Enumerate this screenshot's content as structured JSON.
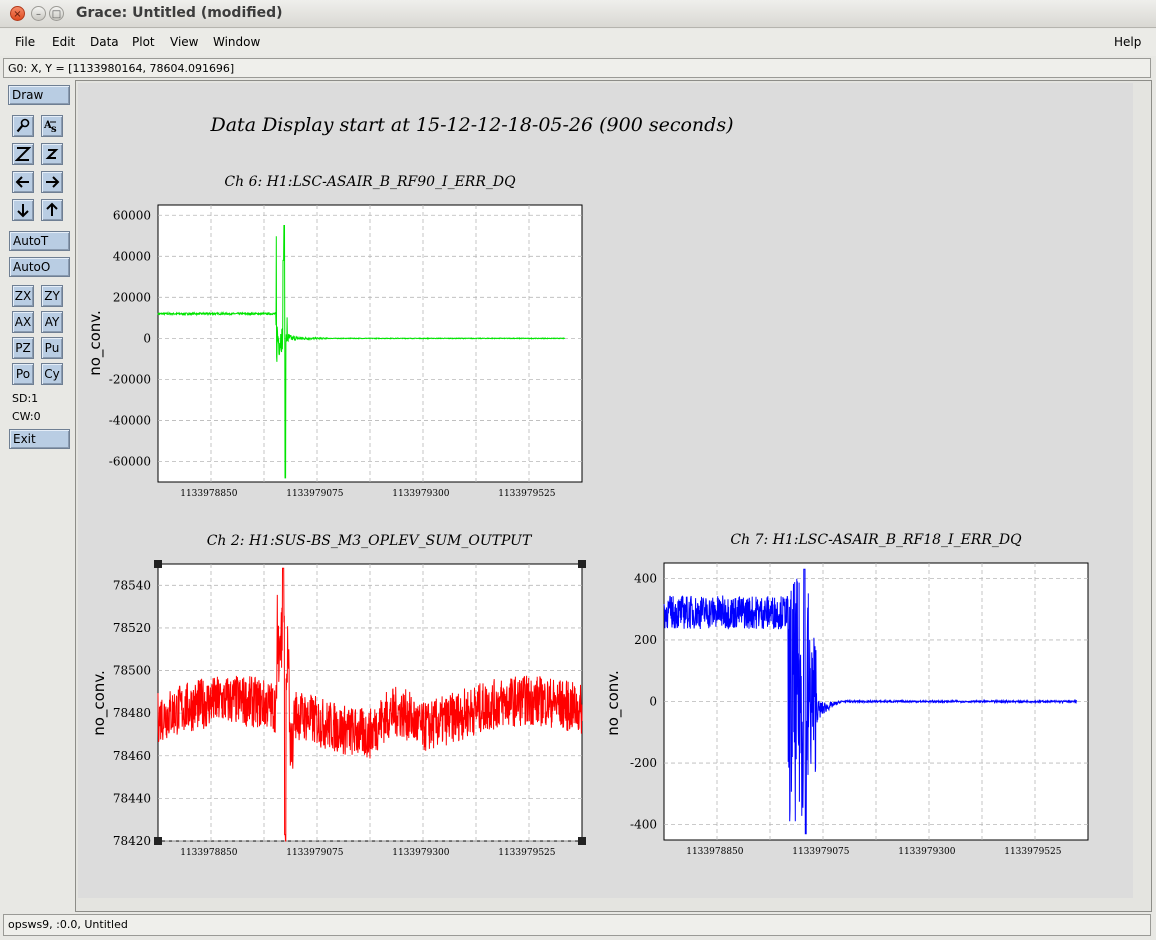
{
  "window": {
    "title": "Grace: Untitled (modified)"
  },
  "menu": {
    "items": [
      "File",
      "Edit",
      "Data",
      "Plot",
      "View",
      "Window"
    ],
    "help": "Help"
  },
  "locator": "G0: X, Y = [1133980164, 78604.091696]",
  "toolbar": {
    "draw": "Draw",
    "autot": "AutoT",
    "autoo": "AutoO",
    "zx": "ZX",
    "zy": "ZY",
    "ax": "AX",
    "ay": "AY",
    "pz": "PZ",
    "pu": "Pu",
    "po": "Po",
    "cy": "Cy",
    "sd": "SD:1",
    "cw": "CW:0",
    "exit": "Exit",
    "icons": [
      "zoom-magnifier-icon",
      "text-autoscale-icon",
      "zoom-z-large-icon",
      "zoom-z-small-icon",
      "scroll-left-icon",
      "scroll-right-icon",
      "scroll-down-icon",
      "scroll-up-icon"
    ]
  },
  "status": "opsws9, :0.0, Untitled",
  "colors": {
    "ch6": "#00e400",
    "ch2": "#ff0000",
    "ch7": "#0000ff"
  },
  "chart_data": {
    "title": "Data Display start at 15-12-12-18-05-26 (900 seconds)",
    "plots": [
      {
        "name": "Ch 6: H1:LSC-ASAIR_B_RF90_I_ERR_DQ",
        "type": "line",
        "ylabel": "no_conv.",
        "ylim": [
          -70000,
          65000
        ],
        "yticks": [
          60000,
          40000,
          20000,
          0,
          -20000,
          -40000,
          -60000
        ],
        "xticks": [
          "1133978850",
          "1133979075",
          "1133979300",
          "1133979525"
        ],
        "description": "flat ~12000 until ~1133978900, burst between ~1133979000 and ~1133979120 (spike to ~55000 and ~-68000), then ~0"
      },
      {
        "name": "Ch 2: H1:SUS-BS_M3_OPLEV_SUM_OUTPUT",
        "type": "line",
        "ylabel": "no_conv.",
        "ylim": [
          78420,
          78550
        ],
        "yticks": [
          78540,
          78520,
          78500,
          78480,
          78460,
          78440,
          78420
        ],
        "xticks": [
          "1133978850",
          "1133979075",
          "1133979300",
          "1133979525"
        ],
        "description": "noisy around 78470-78495, spike to ~78548 and dip to ~78423 near 1133979050"
      },
      {
        "name": "Ch 7: H1:LSC-ASAIR_B_RF18_I_ERR_DQ",
        "type": "line",
        "ylabel": "no_conv.",
        "ylim": [
          -450,
          450
        ],
        "yticks": [
          400,
          200,
          0,
          -200,
          -400
        ],
        "xticks": [
          "1133978850",
          "1133979075",
          "1133979300",
          "1133979525"
        ],
        "description": "noisy ~200-380 until ~1133978900, burst down to ~-430 and up to ~430, then ~0"
      }
    ]
  }
}
